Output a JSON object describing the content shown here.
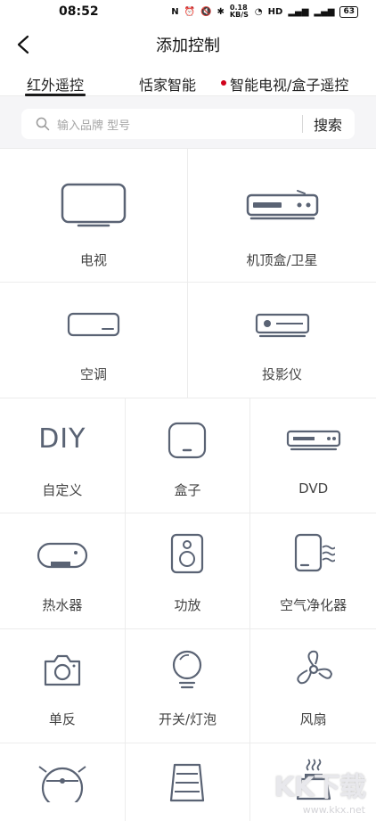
{
  "status_bar": {
    "time": "08:52",
    "network_speed": "0.18 KB/S",
    "battery": "63"
  },
  "header": {
    "title": "添加控制"
  },
  "tabs": [
    {
      "label": "红外遥控",
      "active": true
    },
    {
      "label": "恬家智能",
      "active": false
    },
    {
      "label": "智能电视/盒子遥控",
      "active": false,
      "badge": true
    }
  ],
  "search": {
    "placeholder": "输入品牌 型号",
    "button_label": "搜索"
  },
  "devices": [
    {
      "label": "电视",
      "icon": "tv-icon"
    },
    {
      "label": "机顶盒/卫星",
      "icon": "set-top-box-icon"
    },
    {
      "label": "空调",
      "icon": "air-conditioner-icon"
    },
    {
      "label": "投影仪",
      "icon": "projector-icon"
    },
    {
      "label": "自定义",
      "icon": "diy-icon",
      "icon_text": "DIY"
    },
    {
      "label": "盒子",
      "icon": "box-icon"
    },
    {
      "label": "DVD",
      "icon": "dvd-icon"
    },
    {
      "label": "热水器",
      "icon": "water-heater-icon"
    },
    {
      "label": "功放",
      "icon": "amplifier-icon"
    },
    {
      "label": "空气净化器",
      "icon": "air-purifier-icon"
    },
    {
      "label": "单反",
      "icon": "camera-icon"
    },
    {
      "label": "开关/灯泡",
      "icon": "light-bulb-icon"
    },
    {
      "label": "风扇",
      "icon": "fan-icon"
    },
    {
      "label": "",
      "icon": "robot-vacuum-icon"
    },
    {
      "label": "",
      "icon": "heater-icon"
    },
    {
      "label": "",
      "icon": "humidifier-icon"
    }
  ],
  "watermark": {
    "logo": "KK下载",
    "url": "www.kkx.net"
  },
  "colors": {
    "icon_stroke": "#5a6374",
    "accent_dot": "#d0021b",
    "background": "#f5f5f7"
  }
}
